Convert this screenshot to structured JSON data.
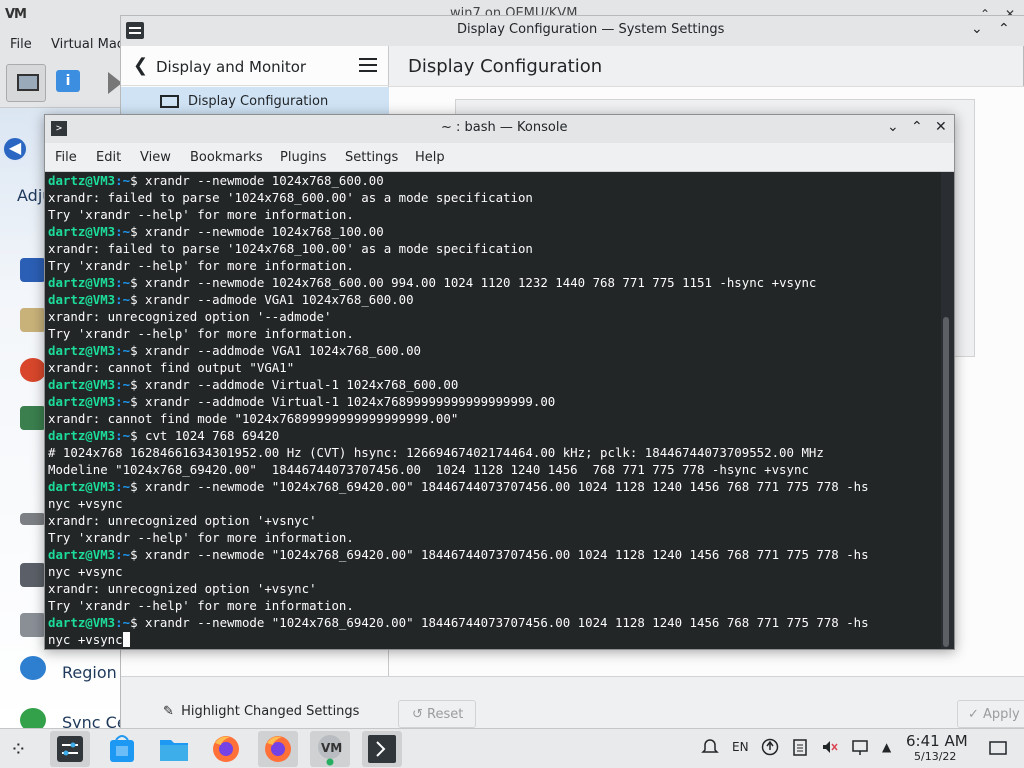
{
  "vm_window": {
    "logo": "VM",
    "title": "win7 on QEMU/KVM",
    "controls": {
      "minimize": "⌄",
      "maximize": "⌃",
      "close": "✕"
    },
    "menu": [
      "File",
      "Virtual Mac"
    ]
  },
  "guest": {
    "back_glyph": "◀",
    "heading": "Adju",
    "items": [
      {
        "label": "Region a",
        "icon": "globe-icon"
      },
      {
        "label": "Sync Cer",
        "icon": "sync-icon"
      }
    ]
  },
  "settings": {
    "window_title": "Display Configuration — System Settings",
    "sidebar_title": "Display and Monitor",
    "sidebar_back": "❮",
    "sidebar_item": "Display Configuration",
    "page_title": "Display Configuration",
    "highlight_label": "Highlight Changed Settings",
    "reset_label": "↺  Reset",
    "apply_label": "✓  Apply",
    "controls": {
      "minimize": "⌄",
      "maximize": "⌃"
    }
  },
  "konsole": {
    "title": "~ : bash — Konsole",
    "menu": [
      "File",
      "Edit",
      "View",
      "Bookmarks",
      "Plugins",
      "Settings",
      "Help"
    ],
    "controls": {
      "minimize": "⌄",
      "maximize": "⌃",
      "close": "✕"
    },
    "prompt_user": "dartz@VM3",
    "prompt_path": ":~",
    "lines": [
      {
        "p": true,
        "t": "$ xrandr --newmode 1024x768_600.00"
      },
      {
        "p": false,
        "t": "xrandr: failed to parse '1024x768_600.00' as a mode specification"
      },
      {
        "p": false,
        "t": "Try 'xrandr --help' for more information."
      },
      {
        "p": true,
        "t": "$ xrandr --newmode 1024x768_100.00"
      },
      {
        "p": false,
        "t": "xrandr: failed to parse '1024x768_100.00' as a mode specification"
      },
      {
        "p": false,
        "t": "Try 'xrandr --help' for more information."
      },
      {
        "p": true,
        "t": "$ xrandr --newmode 1024x768_600.00 994.00 1024 1120 1232 1440 768 771 775 1151 -hsync +vsync"
      },
      {
        "p": true,
        "t": "$ xrandr --admode VGA1 1024x768_600.00"
      },
      {
        "p": false,
        "t": "xrandr: unrecognized option '--admode'"
      },
      {
        "p": false,
        "t": "Try 'xrandr --help' for more information."
      },
      {
        "p": true,
        "t": "$ xrandr --addmode VGA1 1024x768_600.00"
      },
      {
        "p": false,
        "t": "xrandr: cannot find output \"VGA1\""
      },
      {
        "p": true,
        "t": "$ xrandr --addmode Virtual-1 1024x768_600.00"
      },
      {
        "p": true,
        "t": "$ xrandr --addmode Virtual-1 1024x76899999999999999999.00"
      },
      {
        "p": false,
        "t": "xrandr: cannot find mode \"1024x76899999999999999999.00\""
      },
      {
        "p": true,
        "t": "$ cvt 1024 768 69420"
      },
      {
        "p": false,
        "t": "# 1024x768 16284661634301952.00 Hz (CVT) hsync: 12669467402174464.00 kHz; pclk: 18446744073709552.00 MHz"
      },
      {
        "p": false,
        "t": "Modeline \"1024x768_69420.00\"  18446744073707456.00  1024 1128 1240 1456  768 771 775 778 -hsync +vsync"
      },
      {
        "p": true,
        "t": "$ xrandr --newmode \"1024x768_69420.00\" 18446744073707456.00 1024 1128 1240 1456 768 771 775 778 -hs"
      },
      {
        "p": false,
        "t": "nyc +vsync"
      },
      {
        "p": false,
        "t": "xrandr: unrecognized option '+vsnyc'"
      },
      {
        "p": false,
        "t": "Try 'xrandr --help' for more information."
      },
      {
        "p": true,
        "t": "$ xrandr --newmode \"1024x768_69420.00\" 18446744073707456.00 1024 1128 1240 1456 768 771 775 778 -hs"
      },
      {
        "p": false,
        "t": "nyc +vsync"
      },
      {
        "p": false,
        "t": "xrandr: unrecognized option '+vsync'"
      },
      {
        "p": false,
        "t": "Try 'xrandr --help' for more information."
      },
      {
        "p": true,
        "t": "$ xrandr --newmode \"1024x768_69420.00\" 18446744073707456.00 1024 1128 1240 1456 768 771 775 778 -hs"
      },
      {
        "p": false,
        "t": "nyc +vsync",
        "cursor": true
      }
    ]
  },
  "taskbar": {
    "launcher_glyph": "⁘",
    "apps": [
      "system-settings",
      "discover",
      "dolphin",
      "firefox",
      "firefox",
      "virt-manager",
      "konsole"
    ],
    "tray": {
      "language": "EN",
      "show_hidden": "▲"
    },
    "time": "6:41 AM",
    "date": "5/13/22"
  },
  "colors": {
    "terminal_bg": "#232627",
    "prompt_user": "#1cdc9a",
    "prompt_path": "#1d99f3",
    "selection": "#cfe3f5"
  }
}
